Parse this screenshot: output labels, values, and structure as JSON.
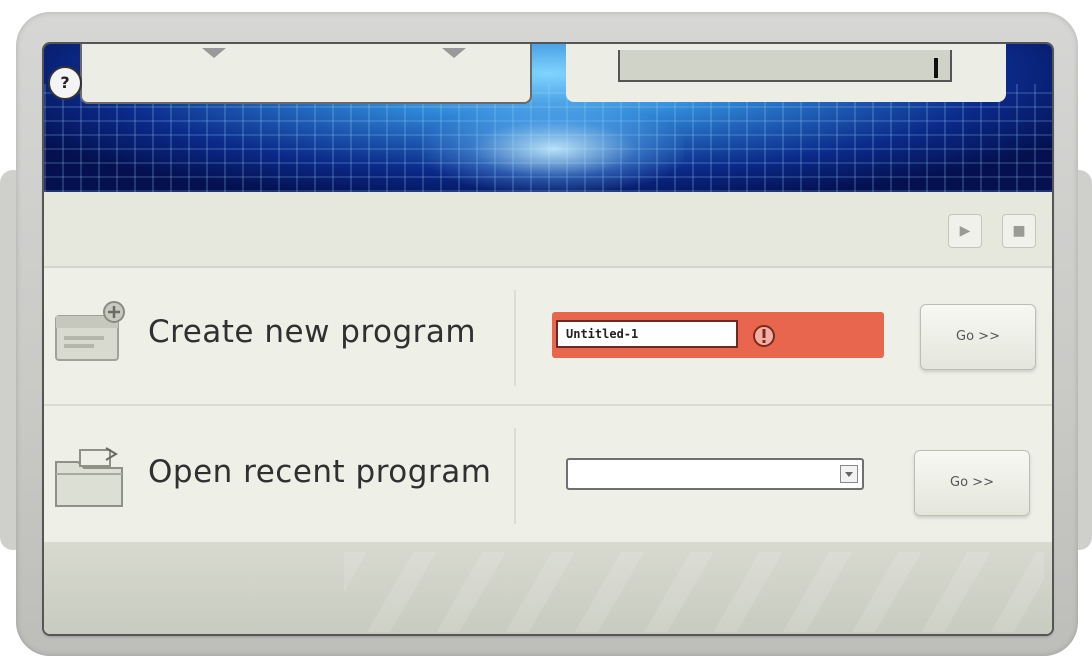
{
  "header": {
    "help_glyph": "?",
    "project_field_value": ""
  },
  "toolbar": {
    "buttons": [
      {
        "icon": "play-icon",
        "glyph": "▶"
      },
      {
        "icon": "stop-icon",
        "glyph": "■"
      }
    ]
  },
  "rows": {
    "create": {
      "label": "Create new program",
      "name_value": "Untitled-1",
      "error_text": "",
      "go_label": "Go >>"
    },
    "open": {
      "label": "Open recent program",
      "selected": "",
      "go_label": "Go >>"
    }
  },
  "colors": {
    "banner": "#0b2a8a",
    "error_bg": "#e8664e",
    "panel": "#eef0e8"
  }
}
